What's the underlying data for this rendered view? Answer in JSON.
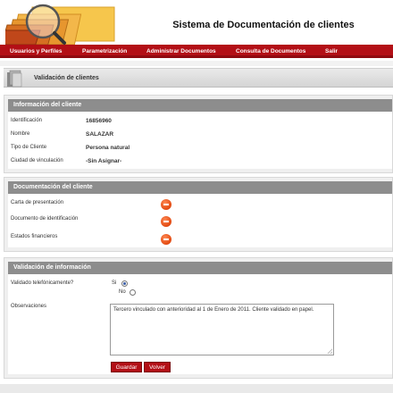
{
  "header": {
    "title": "Sistema de Documentación de clientes"
  },
  "nav": {
    "items": [
      {
        "label": "Usuarios y Perfiles"
      },
      {
        "label": "Parametrización"
      },
      {
        "label": "Administrar Documentos"
      },
      {
        "label": "Consulta de Documentos"
      },
      {
        "label": "Salir"
      }
    ]
  },
  "page": {
    "title": "Validación de clientes"
  },
  "client_info": {
    "heading": "Información del cliente",
    "rows": [
      {
        "label": "Identificación",
        "value": "16856960"
      },
      {
        "label": "Nombre",
        "value": "SALAZAR"
      },
      {
        "label": "Tipo de Cliente",
        "value": "Persona natural"
      },
      {
        "label": "Ciudad de vinculación",
        "value": "-Sin Asignar-"
      }
    ]
  },
  "documents": {
    "heading": "Documentación del cliente",
    "items": [
      {
        "label": "Carta de presentación"
      },
      {
        "label": "Documento de identificación"
      },
      {
        "label": "Estados financieros"
      }
    ]
  },
  "validation": {
    "heading": "Validación de información",
    "phone_label": "Validado telefónicamente?",
    "option_yes": "Si",
    "option_no": "No",
    "selected": "Si",
    "observations_label": "Observaciones",
    "observations_value": "Tercero vinculado con anterioridad al 1 de Enero de 2011. Cliente validado en papel.",
    "save_label": "Guardar",
    "back_label": "Volver"
  },
  "colors": {
    "brand": "#b30f16",
    "section_header": "#8d8d8d",
    "icon_remove": "#e2480f"
  },
  "icons": {
    "logo": "folders-magnifier-icon",
    "page": "folder-icon",
    "remove": "remove-icon"
  }
}
